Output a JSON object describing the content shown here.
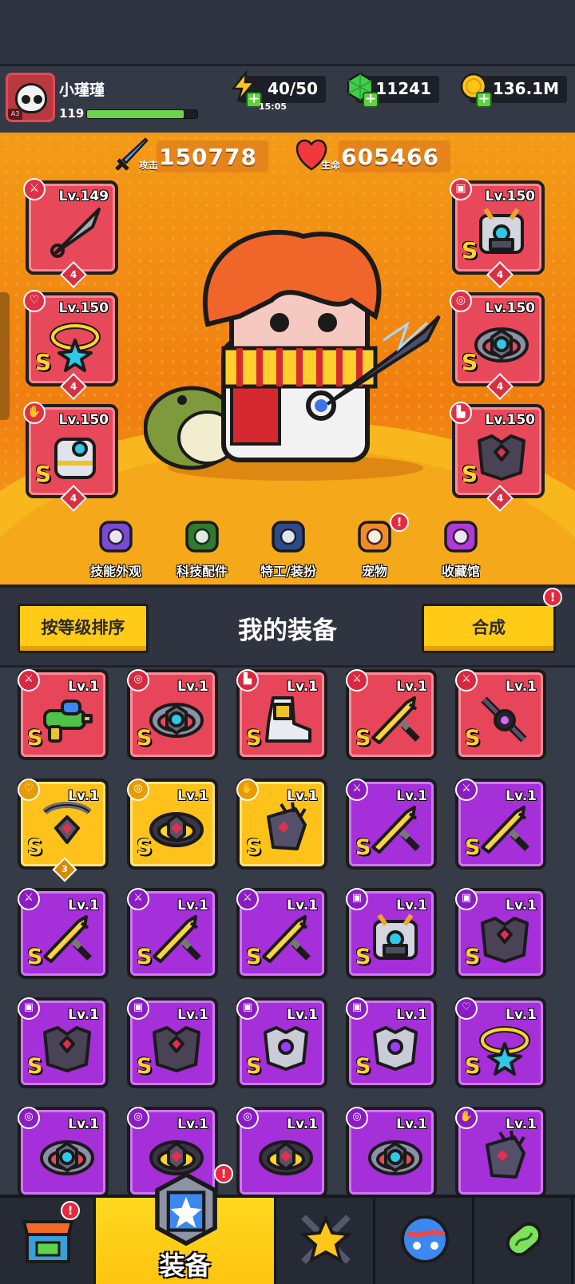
{
  "player": {
    "name": "小瑾瑾",
    "level": "119",
    "rank_badge": "A3",
    "xp_fraction": 0.88
  },
  "resources": {
    "energy": "40/50",
    "energy_timer": "15:05",
    "gems": "11241",
    "coins": "136.1M"
  },
  "stats": {
    "attack_value": "150778",
    "attack_label": "攻击",
    "hp_value": "605466",
    "hp_label": "生命"
  },
  "equipped": {
    "left": [
      {
        "level": "Lv.149",
        "grade": "",
        "count": "4",
        "slot_icon": "weapon-icon"
      },
      {
        "level": "Lv.150",
        "grade": "S",
        "count": "4",
        "slot_icon": "necklace-icon"
      },
      {
        "level": "Lv.150",
        "grade": "S",
        "count": "4",
        "slot_icon": "glove-icon"
      }
    ],
    "right": [
      {
        "level": "Lv.150",
        "grade": "S",
        "count": "4",
        "slot_icon": "armor-icon"
      },
      {
        "level": "Lv.150",
        "grade": "S",
        "count": "4",
        "slot_icon": "belt-icon"
      },
      {
        "level": "Lv.150",
        "grade": "S",
        "count": "4",
        "slot_icon": "boots-icon"
      }
    ]
  },
  "hero_menu": [
    {
      "label": "技能外观",
      "icon": "skill-skin-icon"
    },
    {
      "label": "科技配件",
      "icon": "tech-part-icon"
    },
    {
      "label": "特工/装扮",
      "icon": "agent-costume-icon"
    },
    {
      "label": "宠物",
      "icon": "pet-icon",
      "alert": "!"
    },
    {
      "label": "收藏馆",
      "icon": "collection-icon"
    }
  ],
  "inventory": {
    "title": "我的装备",
    "sort_label": "按等级排序",
    "merge_label": "合成",
    "merge_alert": "!",
    "items": [
      {
        "level": "Lv.1",
        "grade": "S",
        "rarity": "red",
        "slot": "weapon",
        "art": "water-gun"
      },
      {
        "level": "Lv.1",
        "grade": "S",
        "rarity": "red",
        "slot": "belt",
        "art": "belt"
      },
      {
        "level": "Lv.1",
        "grade": "S",
        "rarity": "red",
        "slot": "boots",
        "art": "boots"
      },
      {
        "level": "Lv.1",
        "grade": "S",
        "rarity": "red",
        "slot": "weapon",
        "art": "katana"
      },
      {
        "level": "Lv.1",
        "grade": "S",
        "rarity": "red",
        "slot": "weapon",
        "art": "dark-blade"
      },
      {
        "level": "Lv.1",
        "grade": "S",
        "rarity": "gold",
        "slot": "necklace",
        "art": "chain-necklace",
        "count": "3"
      },
      {
        "level": "Lv.1",
        "grade": "S",
        "rarity": "gold",
        "slot": "belt",
        "art": "dark-belt"
      },
      {
        "level": "Lv.1",
        "grade": "S",
        "rarity": "gold",
        "slot": "glove",
        "art": "claw-glove"
      },
      {
        "level": "Lv.1",
        "grade": "S",
        "rarity": "purple",
        "slot": "weapon",
        "art": "katana"
      },
      {
        "level": "Lv.1",
        "grade": "S",
        "rarity": "purple",
        "slot": "weapon",
        "art": "katana"
      },
      {
        "level": "Lv.1",
        "grade": "S",
        "rarity": "purple",
        "slot": "weapon",
        "art": "katana"
      },
      {
        "level": "Lv.1",
        "grade": "S",
        "rarity": "purple",
        "slot": "weapon",
        "art": "katana"
      },
      {
        "level": "Lv.1",
        "grade": "S",
        "rarity": "purple",
        "slot": "weapon",
        "art": "katana"
      },
      {
        "level": "Lv.1",
        "grade": "S",
        "rarity": "purple",
        "slot": "armor",
        "art": "mech-armor"
      },
      {
        "level": "Lv.1",
        "grade": "S",
        "rarity": "purple",
        "slot": "armor",
        "art": "dark-armor"
      },
      {
        "level": "Lv.1",
        "grade": "S",
        "rarity": "purple",
        "slot": "armor",
        "art": "dark-armor"
      },
      {
        "level": "Lv.1",
        "grade": "S",
        "rarity": "purple",
        "slot": "armor",
        "art": "dark-armor"
      },
      {
        "level": "Lv.1",
        "grade": "S",
        "rarity": "purple",
        "slot": "armor",
        "art": "steel-armor"
      },
      {
        "level": "Lv.1",
        "grade": "S",
        "rarity": "purple",
        "slot": "armor",
        "art": "steel-armor"
      },
      {
        "level": "Lv.1",
        "grade": "S",
        "rarity": "purple",
        "slot": "necklace",
        "art": "star-necklace"
      },
      {
        "level": "Lv.1",
        "grade": "",
        "rarity": "purple",
        "slot": "belt",
        "art": "belt"
      },
      {
        "level": "Lv.1",
        "grade": "",
        "rarity": "purple",
        "slot": "belt",
        "art": "dark-belt"
      },
      {
        "level": "Lv.1",
        "grade": "",
        "rarity": "purple",
        "slot": "belt",
        "art": "dark-belt"
      },
      {
        "level": "Lv.1",
        "grade": "",
        "rarity": "purple",
        "slot": "belt",
        "art": "belt"
      },
      {
        "level": "Lv.1",
        "grade": "",
        "rarity": "purple",
        "slot": "glove",
        "art": "claw-glove"
      }
    ]
  },
  "bottom_nav": [
    {
      "label": "",
      "icon": "shop-icon",
      "alert": "!"
    },
    {
      "label": "装备",
      "icon": "equipment-icon",
      "alert": "!",
      "active": true
    },
    {
      "label": "",
      "icon": "battle-star-icon"
    },
    {
      "label": "",
      "icon": "planet-icon"
    },
    {
      "label": "",
      "icon": "gene-capsule-icon"
    }
  ],
  "colors": {
    "red_rarity": "#e7465a",
    "gold_rarity": "#ffc21b",
    "purple_rarity": "#a52fd9",
    "accent_yellow": "#ffcb16"
  }
}
